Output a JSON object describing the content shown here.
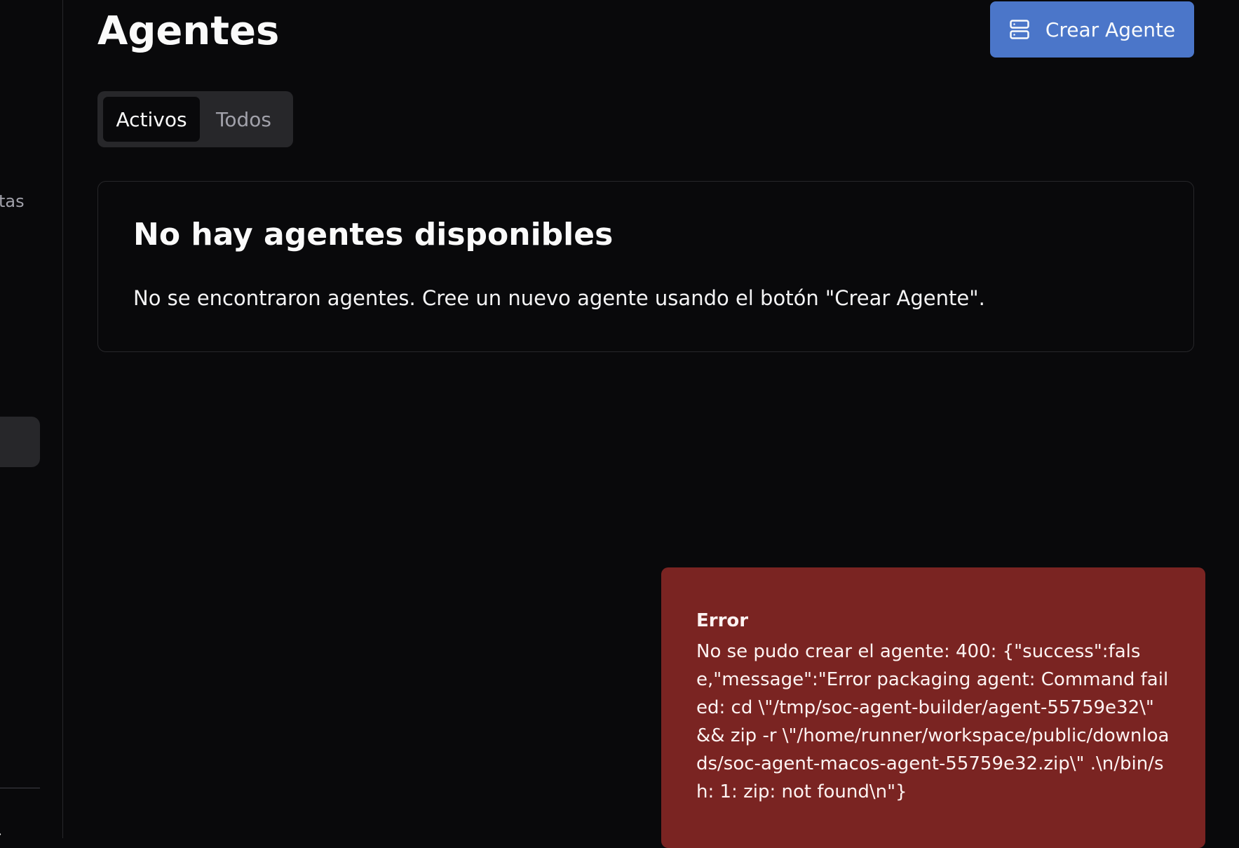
{
  "sidebar": {
    "partial_label": "tas"
  },
  "header": {
    "title": "Agentes",
    "create_button_label": "Crear Agente"
  },
  "tabs": [
    {
      "label": "Activos",
      "active": true
    },
    {
      "label": "Todos",
      "active": false
    }
  ],
  "empty_state": {
    "title": "No hay agentes disponibles",
    "description": "No se encontraron agentes. Cree un nuevo agente usando el botón \"Crear Agente\"."
  },
  "toast": {
    "title": "Error",
    "message": "No se pudo crear el agente: 400: {\"success\":false,\"message\":\"Error packaging agent: Command failed: cd \\\"/tmp/soc-agent-builder/agent-55759e32\\\" && zip -r \\\"/home/runner/workspace/public/downloads/soc-agent-macos-agent-55759e32.zip\\\" .\\n/bin/sh: 1: zip: not found\\n\"}"
  },
  "colors": {
    "background": "#09090b",
    "primary_button": "#4b76c9",
    "error_toast": "#7a2422",
    "border": "#27272a"
  },
  "icons": {
    "create_button_icon": "server-icon",
    "sidebar_chevron": "chevron-right-icon"
  }
}
